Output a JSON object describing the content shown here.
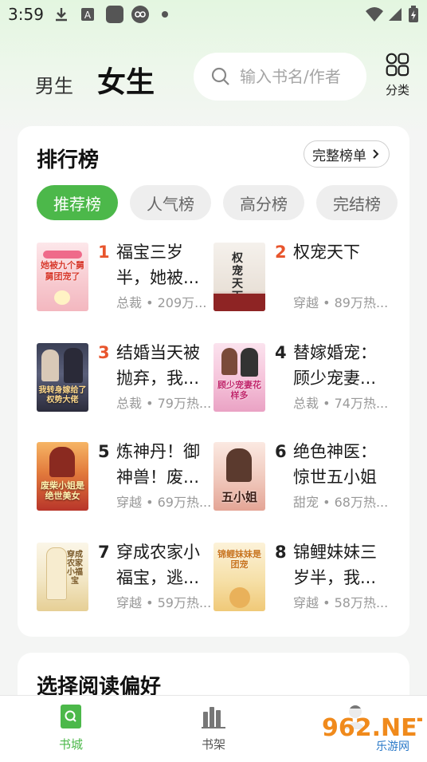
{
  "status_bar": {
    "time": "3:59",
    "icons": [
      "download-icon",
      "a-badge-icon",
      "app-square-icon",
      "infinity-icon",
      "dot-icon",
      "wifi-icon",
      "signal-icon",
      "battery-icon"
    ]
  },
  "header": {
    "tab_male": "男生",
    "tab_female": "女生",
    "search_placeholder": "输入书名/作者",
    "category_label": "分类"
  },
  "ranking": {
    "title": "排行榜",
    "full_list_button": "完整榜单",
    "chips": [
      {
        "label": "推荐榜",
        "active": true
      },
      {
        "label": "人气榜",
        "active": false
      },
      {
        "label": "高分榜",
        "active": false
      },
      {
        "label": "完结榜",
        "active": false
      }
    ],
    "books": [
      {
        "rank": "1",
        "title": "福宝三岁半，她被九个舅舅团宠了",
        "title_display": "福宝三岁半，她被...",
        "meta": "总裁 • 209万...",
        "cover_text": "她被九个舅舅团宠了"
      },
      {
        "rank": "2",
        "title": "权宠天下",
        "title_display": "权宠天下",
        "meta": "穿越 • 89万热...",
        "cover_text": "权宠天下"
      },
      {
        "rank": "3",
        "title": "结婚当天被抛弃，我...",
        "title_display": "结婚当天被抛弃，我...",
        "meta": "总裁 • 79万热...",
        "cover_text": "我转身嫁给了权势大佬"
      },
      {
        "rank": "4",
        "title": "替嫁婚宠：顾少宠妻...",
        "title_display": "替嫁婚宠：顾少宠妻...",
        "meta": "总裁 • 74万热...",
        "cover_text": "顾少宠妻花样多"
      },
      {
        "rank": "5",
        "title": "炼神丹！御神兽！废...",
        "title_display": "炼神丹！御神兽！废...",
        "meta": "穿越 • 69万热...",
        "cover_text": "废柴小姐是绝世美女"
      },
      {
        "rank": "6",
        "title": "绝色神医：惊世五小姐",
        "title_display": "绝色神医：惊世五小姐",
        "meta": "甜宠 • 68万热...",
        "cover_text": "五小姐"
      },
      {
        "rank": "7",
        "title": "穿成农家小福宝，逃...",
        "title_display": "穿成农家小福宝，逃...",
        "meta": "穿越 • 59万热...",
        "cover_text": "穿成农家小福宝"
      },
      {
        "rank": "8",
        "title": "锦鲤妹妹三岁半，我...",
        "title_display": "锦鲤妹妹三岁半，我...",
        "meta": "穿越 • 58万热...",
        "cover_text": "锦鲤妹妹是团宠"
      }
    ]
  },
  "preference": {
    "title": "选择阅读偏好"
  },
  "bottom_nav": [
    {
      "label": "书城",
      "active": true
    },
    {
      "label": "书架",
      "active": false
    },
    {
      "label": "",
      "active": false
    }
  ],
  "watermark": {
    "text": "962.NET",
    "sub": "乐游网"
  },
  "colors": {
    "accent_green": "#4cb84a",
    "rank_hot": "#e8552d",
    "meta_gray": "#999999"
  }
}
